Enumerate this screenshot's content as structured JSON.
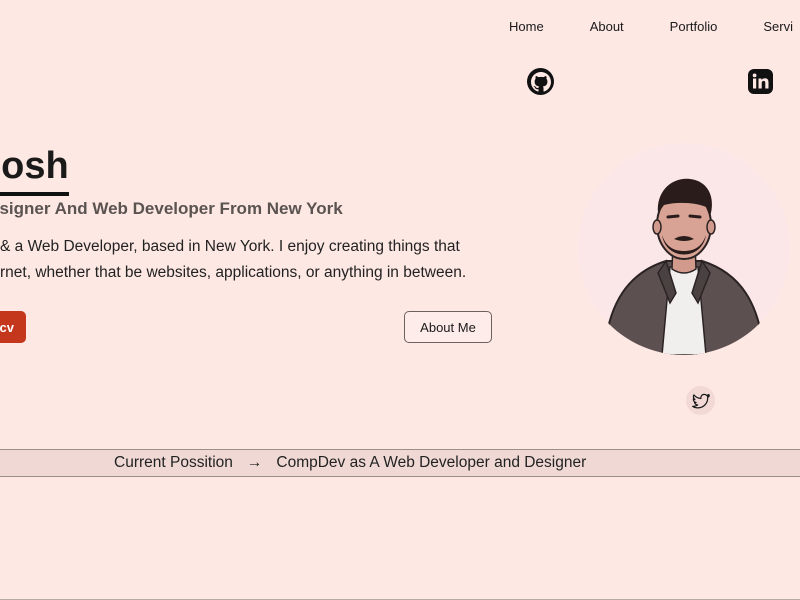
{
  "nav": {
    "items": [
      "Home",
      "About",
      "Portfolio",
      "Servi"
    ]
  },
  "social": {
    "github_icon": "github-icon",
    "linkedin_icon": "linkedin-icon",
    "twitter_icon": "twitter-icon"
  },
  "hero": {
    "name": "Josh",
    "subtitle": "esigner And Web Developer From New York",
    "bio_line_1": "& a Web Developer, based in New York. I enjoy creating things that",
    "bio_line_2": "rnet, whether that be websites, applications, or anything in between.",
    "cv_button": "cv",
    "about_button": "About Me"
  },
  "position": {
    "label": "Current Possition",
    "arrow": "→",
    "value": "CompDev as A Web Developer and Designer"
  },
  "colors": {
    "background": "#fde8e4",
    "accent": "#c4371d"
  }
}
